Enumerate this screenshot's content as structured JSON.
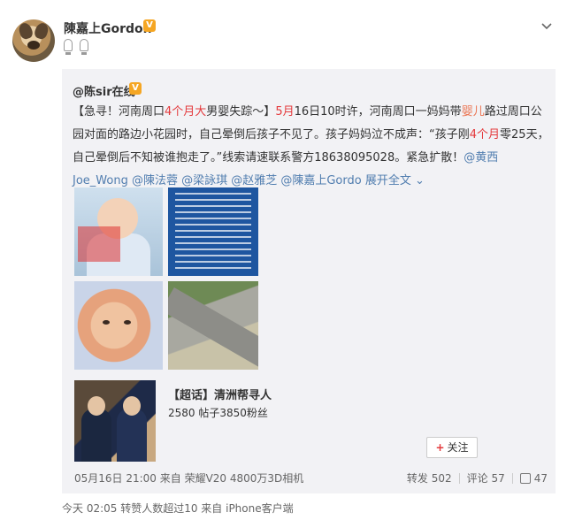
{
  "post": {
    "author": "陳嘉上Gordon",
    "verified_badge": "V",
    "menu_icon": "chevron-down-icon"
  },
  "repost": {
    "original_author": "@陈sir在线",
    "verified_badge": "V",
    "text": {
      "p1": "【急寻！河南周口",
      "p1_red": "4个月大",
      "p2": "男婴失踪～】",
      "p2_red": "5月",
      "p3": "16日10时许，河南周口一妈妈带",
      "p3_link": "婴儿",
      "p4": "路过周口公园对面的路边小花园时，自己晕倒后孩子不见了。孩子妈妈泣不成声：“孩子刚",
      "p4_red": "4个月",
      "p5": "零25天，自己晕倒后不知被谁抱走了。”线索请速联系警方18638095028。紧急扩散！",
      "mentions": "@黄西Joe_Wong @陳法蓉 @梁詠琪 @赵雅芝 @陳嘉上Gordo",
      "expand": "展开全文"
    },
    "topic": {
      "title": "【超话】清洲帮寻人",
      "stats": "2580 帖子3850粉丝",
      "follow_label": "关注",
      "follow_plus": "+"
    },
    "meta": "05月16日 21:00 来自 荣耀V20 4800万3D相机",
    "reposts": "转发 502",
    "comments": "评论 57",
    "likes": "47"
  },
  "footer": "今天 02:05 转赞人数超过10 来自 iPhone客户端",
  "colors": {
    "accent_red": "#e4393c",
    "link_blue": "#507daf",
    "badge_orange": "#f5a623"
  }
}
